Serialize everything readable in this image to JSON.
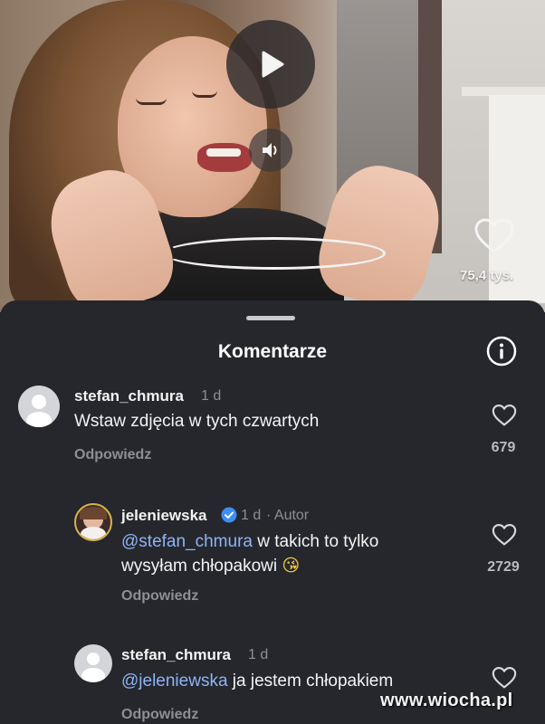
{
  "video": {
    "play_icon": "play-icon",
    "sound_icon": "speaker-icon",
    "like_icon": "heart-icon",
    "like_count": "75,4 tys."
  },
  "comments_panel": {
    "title": "Komentarze",
    "info_icon": "info-icon",
    "comments": [
      {
        "username": "stefan_chmura",
        "time": "1 d",
        "text": "Wstaw zdjęcia w tych czwartych",
        "reply_label": "Odpowiedz",
        "like_count": "679"
      },
      {
        "username": "jeleniewska",
        "time": "1 d",
        "author_label": "· Autor",
        "verified_icon": "verified-badge-icon",
        "mention": "@stefan_chmura",
        "text_line1_rest": " w takich to tylko",
        "text_line2": "wysyłam chłopakowi",
        "emoji": "😘",
        "reply_label": "Odpowiedz",
        "like_count": "2729"
      },
      {
        "username": "stefan_chmura",
        "time": "1 d",
        "mention": "@jeleniewska",
        "text_rest": " ja jestem chłopakiem",
        "reply_label": "Odpowiedz",
        "like_count": ""
      }
    ]
  },
  "watermark": "www.wiocha.pl"
}
